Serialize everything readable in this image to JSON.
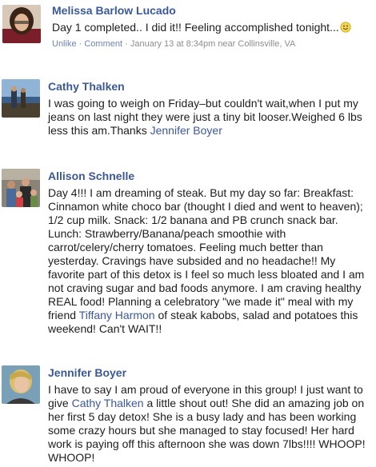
{
  "posts": [
    {
      "author": "Melissa Barlow Lucado",
      "text": "Day 1 completed.. I did it!! Feeling accomplished tonight...",
      "emoticon": "smiley-face-icon",
      "actions": {
        "unlike": "Unlike",
        "sep1": "·",
        "comment": "Comment",
        "sep2": "·",
        "timestamp": "January 13 at 8:34pm near Collinsville, VA"
      }
    },
    {
      "author": "Cathy Thalken",
      "text_before": "I was going to weigh on Friday–but couldn't wait,when I put my jeans on last night they were just a tiny bit looser.Weighed 6 lbs less this am.Thanks ",
      "mention": "Jennifer Boyer"
    },
    {
      "author": "Allison Schnelle",
      "text_before": "Day 4!!! I am dreaming of steak. But my day so far: Breakfast: Cinnamon white choco bar (thought I died and went to heaven); 1/2 cup milk. Snack: 1/2 banana and PB crunch snack bar. Lunch: Strawberry/Banana/peach smoothie with carrot/celery/cherry tomatoes. Feeling much better than yesterday. Cravings have subsided and no headache!! My favorite part of this detox is I feel so much less bloated and I am not craving sugar and bad foods anymore. I am craving healthy REAL food! Planning a celebratory \"we made it\" meal with my friend ",
      "mention": "Tiffany Harmon",
      "text_after": " of steak kabobs, salad and potatoes this weekend! Can't WAIT!!"
    },
    {
      "author": "Jennifer Boyer",
      "text_before": "I have to say I am proud of everyone in this group! I just want to give ",
      "mention": "Cathy Thalken",
      "text_after": " a little shout out! She did an amazing job on her first 5 day detox! She is a busy lady and has been working some crazy hours but she managed to stay focused! Her hard work is paying off this afternoon she was down 7lbs!!!! WHOOP! WHOOP!"
    }
  ],
  "colors": {
    "author": "#3b5998",
    "link": "#3b5998",
    "meta": "#8d8d8d",
    "meta_link": "#6d84b4",
    "text": "#1d1d1d"
  }
}
